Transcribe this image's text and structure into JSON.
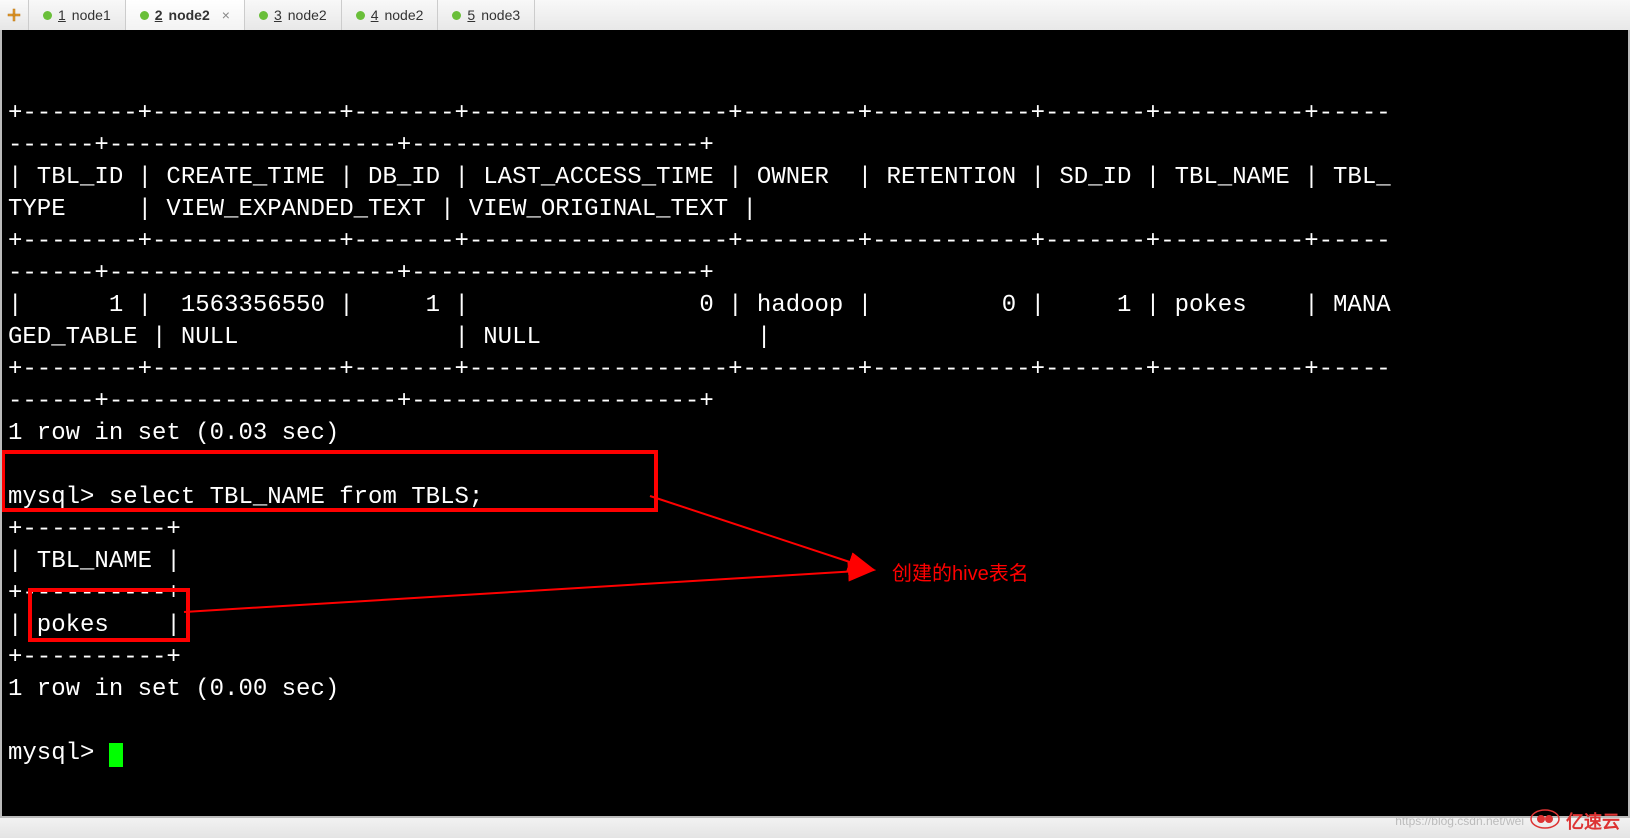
{
  "tabs": [
    {
      "num": "1",
      "name": "node1",
      "dot": "#6abf3a",
      "active": false
    },
    {
      "num": "2",
      "name": "node2",
      "dot": "#6abf3a",
      "active": true
    },
    {
      "num": "3",
      "name": "node2",
      "dot": "#6abf3a",
      "active": false
    },
    {
      "num": "4",
      "name": "node2",
      "dot": "#6abf3a",
      "active": false
    },
    {
      "num": "5",
      "name": "node3",
      "dot": "#6abf3a",
      "active": false
    }
  ],
  "terminal": {
    "lines": [
      "+--------+-------------+-------+------------------+--------+-----------+-------+----------+-----",
      "------+--------------------+--------------------+",
      "| TBL_ID | CREATE_TIME | DB_ID | LAST_ACCESS_TIME | OWNER  | RETENTION | SD_ID | TBL_NAME | TBL_",
      "TYPE     | VIEW_EXPANDED_TEXT | VIEW_ORIGINAL_TEXT |",
      "+--------+-------------+-------+------------------+--------+-----------+-------+----------+-----",
      "------+--------------------+--------------------+",
      "|      1 |  1563356550 |     1 |                0 | hadoop |         0 |     1 | pokes    | MANA",
      "GED_TABLE | NULL               | NULL               |",
      "+--------+-------------+-------+------------------+--------+-----------+-------+----------+-----",
      "------+--------------------+--------------------+",
      "1 row in set (0.03 sec)",
      "",
      "mysql> select TBL_NAME from TBLS;",
      "+----------+",
      "| TBL_NAME |",
      "+----------+",
      "| pokes    |",
      "+----------+",
      "1 row in set (0.00 sec)",
      "",
      "mysql> "
    ]
  },
  "annotation": {
    "label": "创建的hive表名"
  },
  "watermark": {
    "url": "https://blog.csdn.net/wei",
    "brand": "亿速云"
  }
}
